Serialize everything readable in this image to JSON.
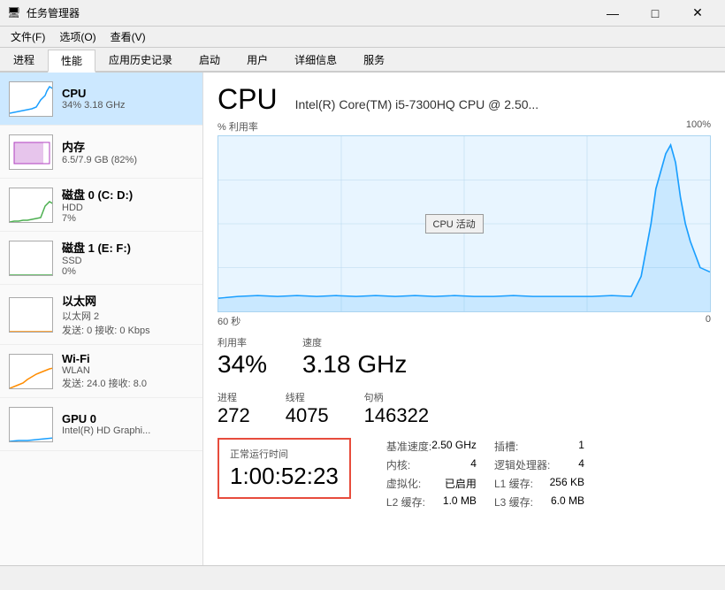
{
  "titleBar": {
    "icon": "🖥",
    "title": "任务管理器",
    "minimizeLabel": "—",
    "maximizeLabel": "□",
    "closeLabel": "✕"
  },
  "menuBar": {
    "items": [
      "文件(F)",
      "选项(O)",
      "查看(V)"
    ]
  },
  "tabs": {
    "items": [
      "进程",
      "性能",
      "应用历史记录",
      "启动",
      "用户",
      "详细信息",
      "服务"
    ],
    "activeIndex": 1
  },
  "sidebar": {
    "items": [
      {
        "id": "cpu",
        "label": "CPU",
        "sub1": "34% 3.18 GHz",
        "sub2": "",
        "active": true
      },
      {
        "id": "memory",
        "label": "内存",
        "sub1": "6.5/7.9 GB (82%)",
        "sub2": "",
        "active": false
      },
      {
        "id": "disk0",
        "label": "磁盘 0 (C: D:)",
        "sub1": "HDD",
        "sub2": "7%",
        "active": false
      },
      {
        "id": "disk1",
        "label": "磁盘 1 (E: F:)",
        "sub1": "SSD",
        "sub2": "0%",
        "active": false
      },
      {
        "id": "ethernet",
        "label": "以太网",
        "sub1": "以太网 2",
        "sub2": "发送: 0 接收: 0 Kbps",
        "active": false
      },
      {
        "id": "wifi",
        "label": "Wi-Fi",
        "sub1": "WLAN",
        "sub2": "发送: 24.0 接收: 8.0",
        "active": false
      },
      {
        "id": "gpu",
        "label": "GPU 0",
        "sub1": "Intel(R) HD Graphi...",
        "sub2": "",
        "active": false
      }
    ]
  },
  "cpuPanel": {
    "title": "CPU",
    "modelName": "Intel(R) Core(TM) i5-7300HQ CPU @ 2.50...",
    "chartLabel": "% 利用率",
    "chartMax": "100%",
    "chartTimeLeft": "60 秒",
    "chartTimeRight": "0",
    "tooltip": "CPU 活动",
    "utilizationLabel": "利用率",
    "utilizationValue": "34%",
    "speedLabel": "速度",
    "speedValue": "3.18 GHz",
    "processLabel": "进程",
    "processValue": "272",
    "threadLabel": "线程",
    "threadValue": "4075",
    "handleLabel": "句柄",
    "handleValue": "146322",
    "uptimeLabel": "正常运行时间",
    "uptimeValue": "1:00:52:23",
    "rightInfo": [
      {
        "key": "基准速度:",
        "value": "2.50 GHz"
      },
      {
        "key": "插槽:",
        "value": "1"
      },
      {
        "key": "内核:",
        "value": "4"
      },
      {
        "key": "逻辑处理器:",
        "value": "4"
      },
      {
        "key": "虚拟化:",
        "value": "已启用"
      },
      {
        "key": "L1 缓存:",
        "value": "256 KB"
      },
      {
        "key": "L2 缓存:",
        "value": "1.0 MB"
      },
      {
        "key": "L3 缓存:",
        "value": "6.0 MB"
      }
    ]
  },
  "bottomBar": {
    "text": ""
  }
}
